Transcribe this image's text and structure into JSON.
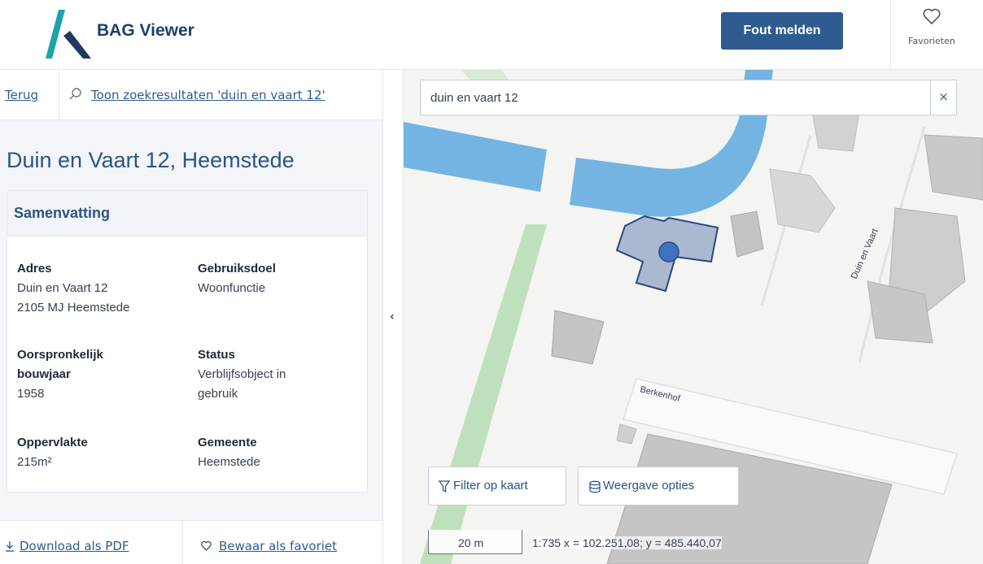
{
  "header": {
    "app_title": "BAG Viewer",
    "report_button": "Fout melden",
    "favorites_label": "Favorieten",
    "brand_color": "#2f5c90"
  },
  "subnav": {
    "back_label": "Terug",
    "results_label": "Toon zoekresultaten 'duin en vaart 12'"
  },
  "object": {
    "title": "Duin en Vaart 12, Heemstede",
    "summary_heading": "Samenvatting",
    "fields": {
      "address": {
        "label": "Adres",
        "line1": "Duin en Vaart 12",
        "line2": "2105 MJ Heemstede"
      },
      "purpose": {
        "label": "Gebruiksdoel",
        "value": "Woonfunctie"
      },
      "build_year": {
        "label_line1": "Oorspronkelijk",
        "label_line2": "bouwjaar",
        "value": "1958"
      },
      "status": {
        "label": "Status",
        "value_line1": "Verblijfsobject in",
        "value_line2": "gebruik"
      },
      "area": {
        "label": "Oppervlakte",
        "value": "215m²"
      },
      "municipality": {
        "label": "Gemeente",
        "value": "Heemstede"
      }
    }
  },
  "actions": {
    "download_pdf": "Download als PDF",
    "save_favorite": "Bewaar als favoriet"
  },
  "map": {
    "search_value": "duin en vaart 12",
    "street_label_1": "Duin en Vaart",
    "street_label_2": "Berkenhof",
    "filter_button": "Filter op kaart",
    "display_button": "Weergave opties",
    "scale_label": "20 m",
    "coords_text": "1:735  x = 102.251,08; y = 485.440,07"
  }
}
